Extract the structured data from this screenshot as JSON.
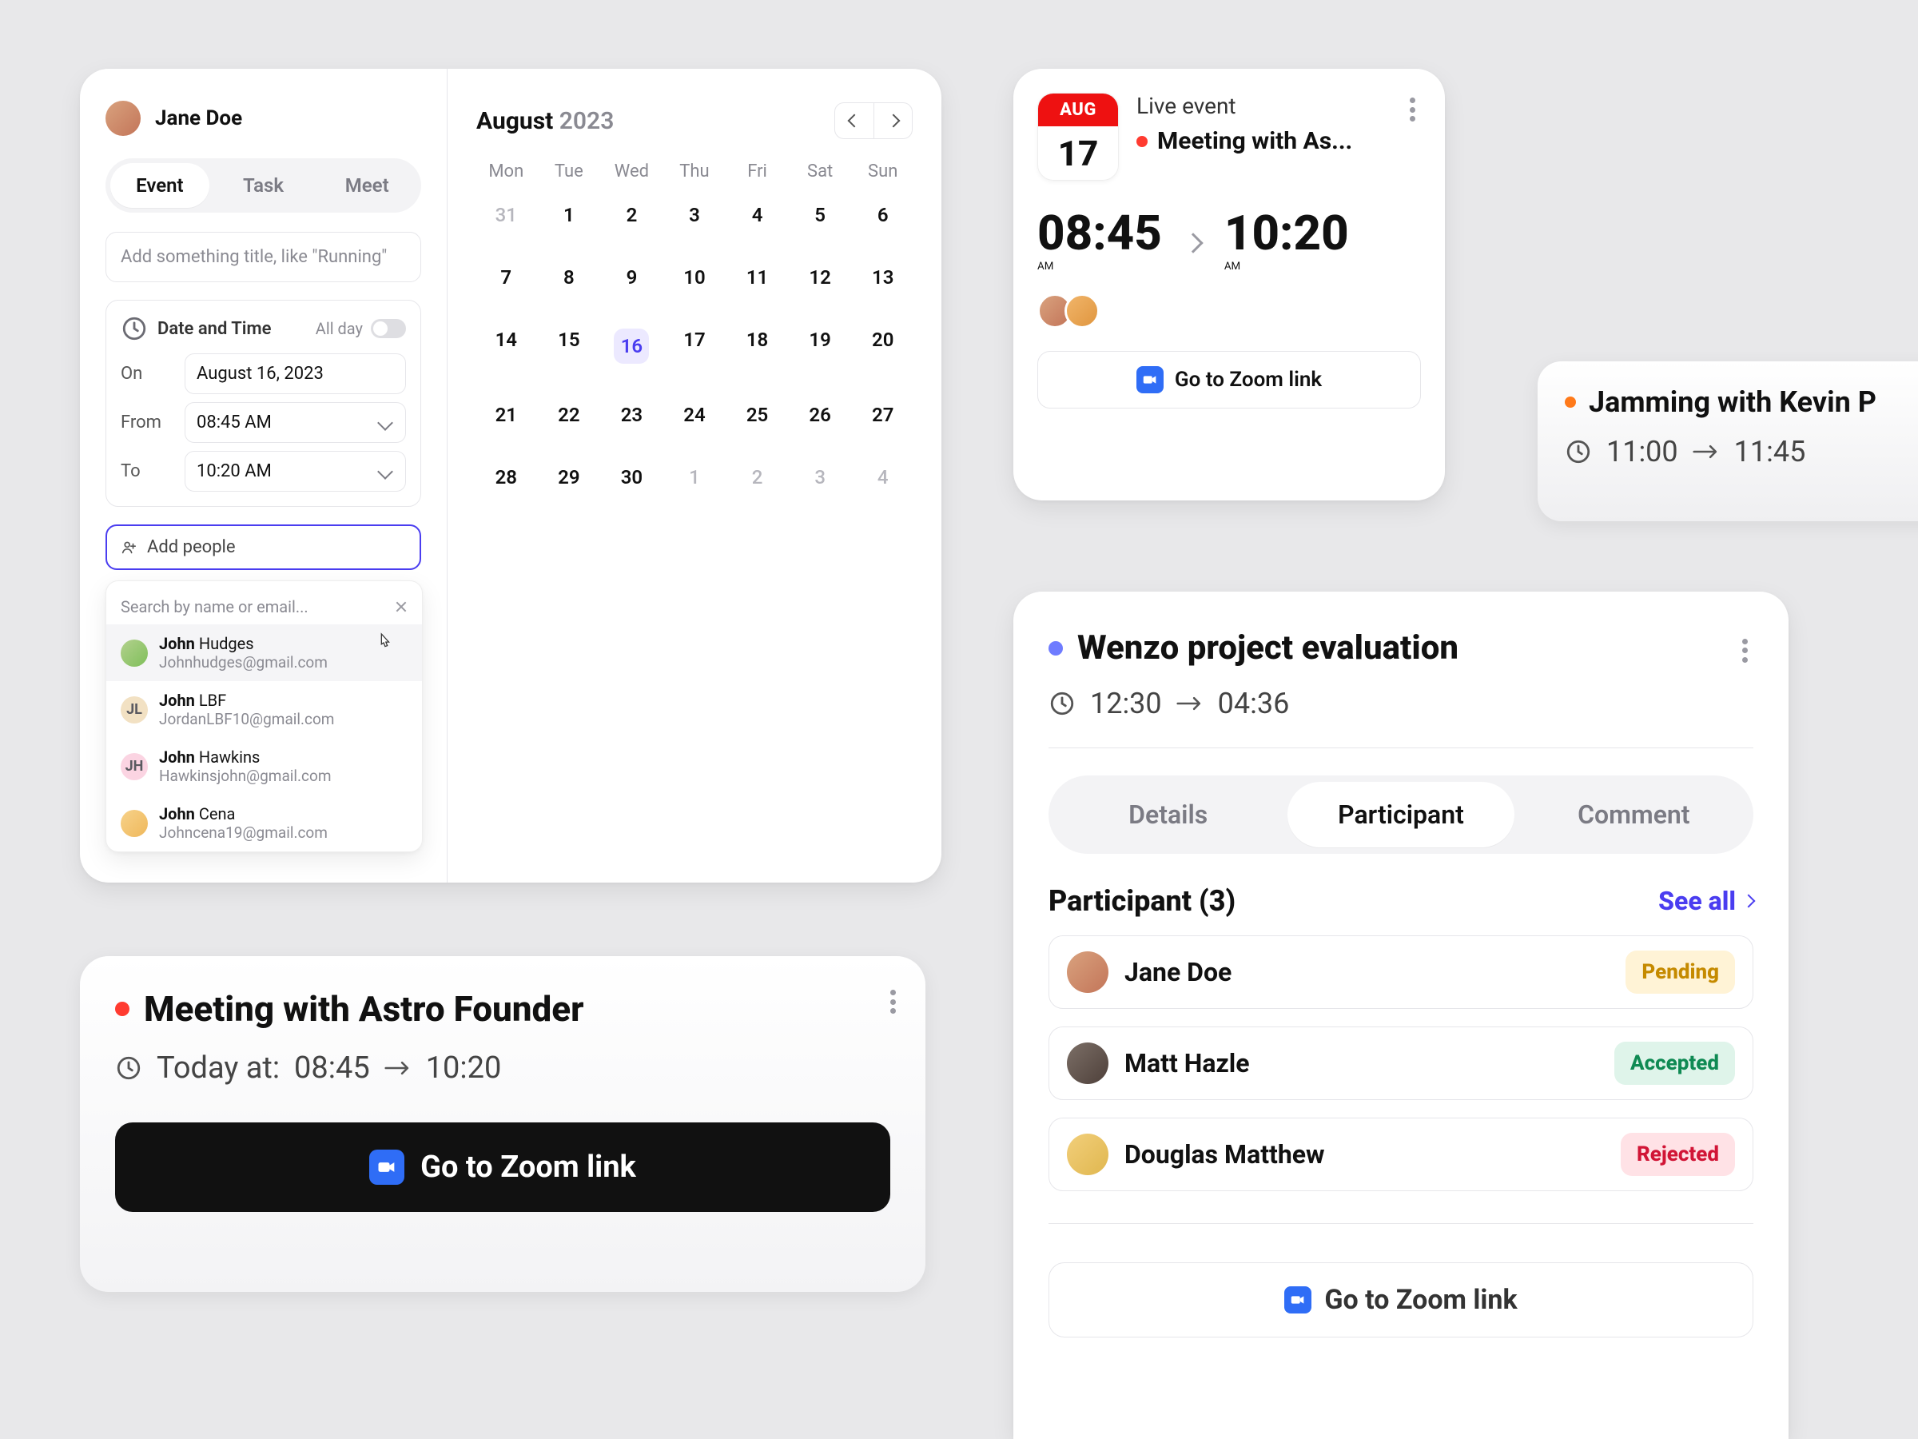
{
  "create": {
    "user_name": "Jane Doe",
    "tabs": {
      "event": "Event",
      "task": "Task",
      "meet": "Meet"
    },
    "title_placeholder": "Add something title, like \"Running\"",
    "dt": {
      "label": "Date and Time",
      "allday_label": "All day",
      "on_label": "On",
      "from_label": "From",
      "to_label": "To",
      "on_value": "August 16, 2023",
      "from_value": "08:45 AM",
      "to_value": "10:20 AM"
    },
    "add_people_label": "Add people",
    "dd": {
      "search_placeholder": "Search by name or email...",
      "items": [
        {
          "first": "John",
          "rest": " Hudges",
          "email": "Johnhudges@gmail.com"
        },
        {
          "first": "John",
          "rest": " LBF",
          "email": "JordanLBF10@gmail.com",
          "initials": "JL"
        },
        {
          "first": "John",
          "rest": " Hawkins",
          "email": "Hawkinsjohn@gmail.com",
          "initials": "JH"
        },
        {
          "first": "John",
          "rest": " Cena",
          "email": "Johncena19@gmail.com"
        }
      ]
    }
  },
  "calendar": {
    "month": "August",
    "year": "2023",
    "dow": [
      "Mon",
      "Tue",
      "Wed",
      "Thu",
      "Fri",
      "Sat",
      "Sun"
    ],
    "days": [
      {
        "n": "31",
        "muted": true
      },
      {
        "n": "1"
      },
      {
        "n": "2"
      },
      {
        "n": "3"
      },
      {
        "n": "4"
      },
      {
        "n": "5"
      },
      {
        "n": "6"
      },
      {
        "n": "7"
      },
      {
        "n": "8"
      },
      {
        "n": "9"
      },
      {
        "n": "10"
      },
      {
        "n": "11"
      },
      {
        "n": "12"
      },
      {
        "n": "13"
      },
      {
        "n": "14"
      },
      {
        "n": "15"
      },
      {
        "n": "16",
        "selected": true
      },
      {
        "n": "17"
      },
      {
        "n": "18"
      },
      {
        "n": "19"
      },
      {
        "n": "20"
      },
      {
        "n": "21"
      },
      {
        "n": "22"
      },
      {
        "n": "23"
      },
      {
        "n": "24"
      },
      {
        "n": "25"
      },
      {
        "n": "26"
      },
      {
        "n": "27"
      },
      {
        "n": "28"
      },
      {
        "n": "29"
      },
      {
        "n": "30"
      },
      {
        "n": "1",
        "muted": true
      },
      {
        "n": "2",
        "muted": true
      },
      {
        "n": "3",
        "muted": true
      },
      {
        "n": "4",
        "muted": true
      }
    ]
  },
  "mini": {
    "month_badge": "AUG",
    "day_badge": "17",
    "line1": "Live event",
    "line2": "Meeting with As...",
    "t_from": "08:45",
    "t_from_ampm": "AM",
    "t_to": "10:20",
    "t_to_ampm": "AM",
    "zoom_label": "Go to Zoom link"
  },
  "strip": {
    "title": "Jamming with Kevin P",
    "from": "11:00",
    "to": "11:45"
  },
  "meeting": {
    "title": "Meeting with Astro Founder",
    "today_prefix": "Today at:",
    "from": "08:45",
    "to": "10:20",
    "zoom_label": "Go to Zoom link"
  },
  "detail": {
    "title": "Wenzo project evaluation",
    "from": "12:30",
    "to": "04:36",
    "tabs": {
      "details": "Details",
      "participant": "Participant",
      "comment": "Comment"
    },
    "part_label": "Participant (3)",
    "see_all": "See all",
    "participants": [
      {
        "name": "Jane Doe",
        "status": "Pending"
      },
      {
        "name": "Matt Hazle",
        "status": "Accepted"
      },
      {
        "name": "Douglas Matthew",
        "status": "Rejected"
      }
    ],
    "zoom_label": "Go to Zoom link"
  }
}
